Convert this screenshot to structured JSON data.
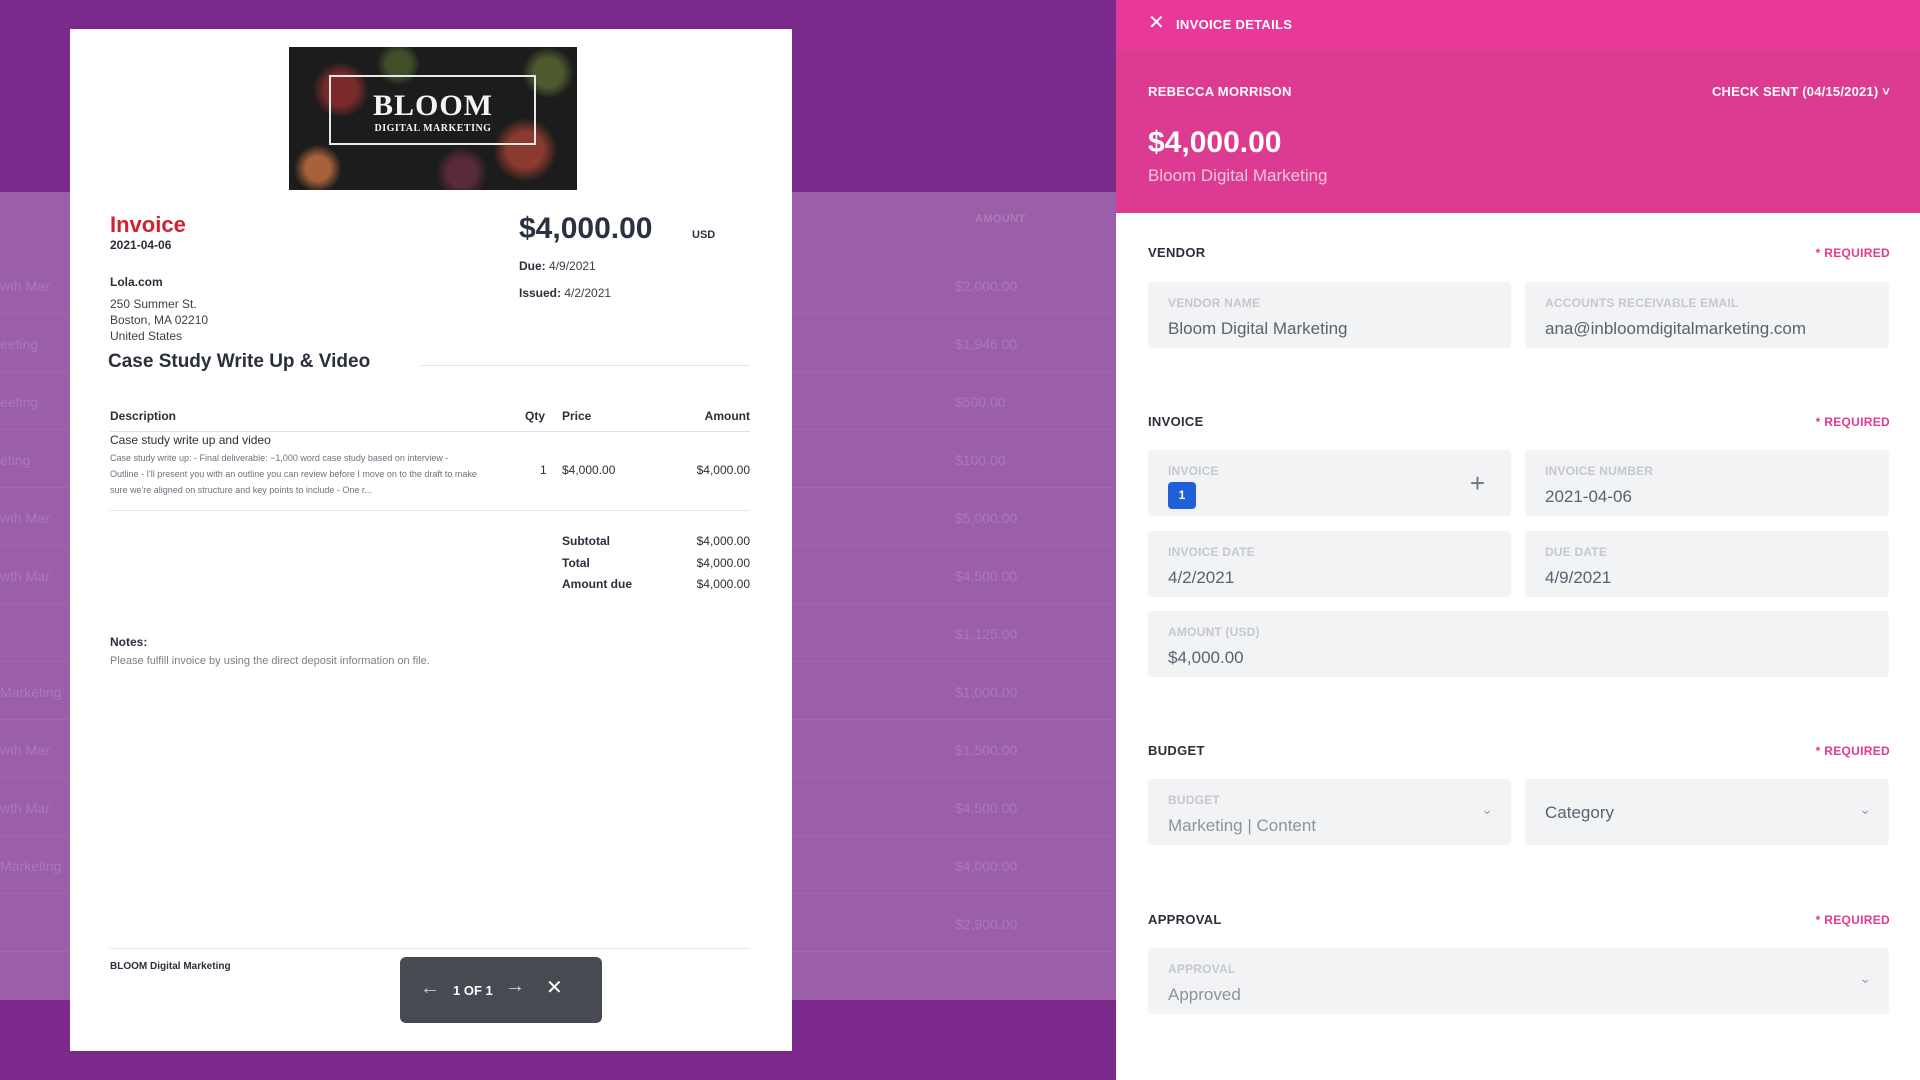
{
  "background": {
    "amount_header": "AMOUNT",
    "rows": [
      {
        "left": "wth Mar",
        "right": "$2,000.00"
      },
      {
        "left": "eeting",
        "right": "$1,946.00"
      },
      {
        "left": "eeting",
        "right": "$500.00"
      },
      {
        "left": "eting",
        "right": "$100.00"
      },
      {
        "left": "wth Mar",
        "right": "$5,000.00"
      },
      {
        "left": "wth Mar",
        "right": "$4,500.00"
      },
      {
        "left": "",
        "right": "$1,125.00"
      },
      {
        "left": "Marketing",
        "right": "$1,000.00"
      },
      {
        "left": "wth Mar",
        "right": "$1,500.00"
      },
      {
        "left": "wth Mar",
        "right": "$4,500.00"
      },
      {
        "left": "Marketing",
        "right": "$4,000.00"
      },
      {
        "left": "",
        "right": "$2,900.00"
      }
    ]
  },
  "document": {
    "logo_title": "BLOOM",
    "logo_subtitle": "DIGITAL MARKETING",
    "label": "Invoice",
    "number": "2021-04-06",
    "from_company": "Lola.com",
    "from_street": "250 Summer St.",
    "from_city": "Boston, MA 02210",
    "from_country": "United States",
    "amount": "$4,000.00",
    "currency": "USD",
    "due_label": "Due:",
    "due_value": "4/9/2021",
    "issued_label": "Issued:",
    "issued_value": "4/2/2021",
    "project_title": "Case Study Write Up & Video",
    "columns": {
      "description": "Description",
      "qty": "Qty",
      "price": "Price",
      "amount": "Amount"
    },
    "line_item": {
      "name": "Case study write up and video",
      "description": "Case study write up: - Final deliverable: ~1,000 word case study based on interview - Outline - I'll present you with an outline you can review before I move on to the draft to make sure we're aligned on structure and key points to include - One r...",
      "qty": "1",
      "price": "$4,000.00",
      "amount": "$4,000.00"
    },
    "subtotal_label": "Subtotal",
    "subtotal_value": "$4,000.00",
    "total_label": "Total",
    "total_value": "$4,000.00",
    "amount_due_label": "Amount due",
    "amount_due_value": "$4,000.00",
    "notes_label": "Notes:",
    "notes_text": "Please fulfill invoice by using the direct deposit information on file.",
    "footer_company": "BLOOM Digital Marketing"
  },
  "pager": {
    "prev_icon": "←",
    "count": "1 OF 1",
    "next_icon": "→",
    "close_icon": "✕"
  },
  "panel": {
    "close_icon": "✕",
    "title": "INVOICE DETAILS",
    "requester": "REBECCA MORRISON",
    "status": "CHECK SENT (04/15/2021) ˅",
    "amount": "$4,000.00",
    "vendor": "Bloom Digital Marketing",
    "required": "* REQUIRED",
    "vendor_section": {
      "heading": "VENDOR",
      "name_label": "VENDOR NAME",
      "name_value": "Bloom Digital Marketing",
      "email_label": "ACCOUNTS RECEIVABLE EMAIL",
      "email_value": "ana@inbloomdigitalmarketing.com"
    },
    "invoice_section": {
      "heading": "INVOICE",
      "invoice_label": "INVOICE",
      "invoice_badge": "1",
      "add_icon": "+",
      "number_label": "INVOICE NUMBER",
      "number_value": "2021-04-06",
      "date_label": "INVOICE DATE",
      "date_value": "4/2/2021",
      "due_label": "DUE DATE",
      "due_value": "4/9/2021",
      "amount_label": "AMOUNT (USD)",
      "amount_value": "$4,000.00"
    },
    "budget_section": {
      "heading": "BUDGET",
      "budget_label": "BUDGET",
      "budget_value": "Marketing | Content",
      "category_placeholder": "Category"
    },
    "approval_section": {
      "heading": "APPROVAL",
      "approval_label": "APPROVAL",
      "approval_value": "Approved"
    },
    "chevron_icon": "⌄"
  },
  "colors": {
    "overlay_purple": "#7b2a8c",
    "panel_pink_header": "#e8399a",
    "panel_pink_body": "#dd3a91",
    "required_pink": "#e23a8f",
    "invoice_red": "#d0212f",
    "badge_blue": "#1f5fd8"
  }
}
